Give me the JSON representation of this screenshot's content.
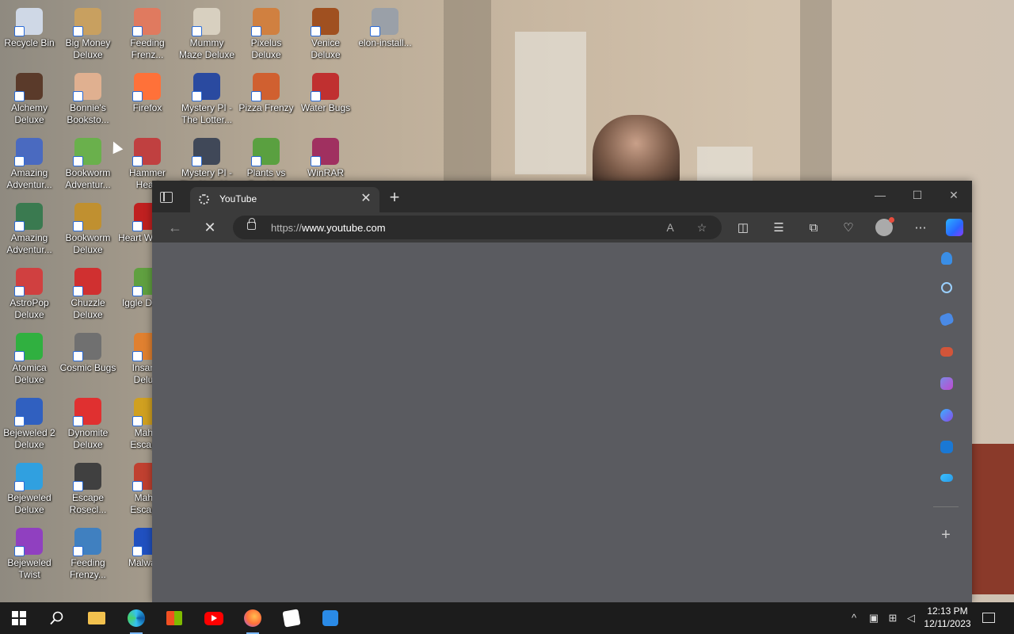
{
  "desktop": {
    "icons": [
      {
        "label": "Recycle Bin",
        "icon": "recycle-bin-icon",
        "color": "#cfd8e6"
      },
      {
        "label": "Big Money Deluxe",
        "icon": "money-bag-icon",
        "color": "#c8a060"
      },
      {
        "label": "Feeding Frenz...",
        "icon": "fish-icon",
        "color": "#e07a5f"
      },
      {
        "label": "Mummy Maze Deluxe",
        "icon": "mummy-icon",
        "color": "#d8d0c0"
      },
      {
        "label": "Pixelus Deluxe",
        "icon": "pixelus-icon",
        "color": "#d08040"
      },
      {
        "label": "Venice Deluxe",
        "icon": "gondola-icon",
        "color": "#a05020"
      },
      {
        "label": "elon-install...",
        "icon": "installer-icon",
        "color": "#9aa0a8"
      },
      {
        "label": "Alchemy Deluxe",
        "icon": "wizard-icon",
        "color": "#5a3a2a"
      },
      {
        "label": "Bonnie's Booksto...",
        "icon": "bonnie-icon",
        "color": "#e0b090"
      },
      {
        "label": "Firefox",
        "icon": "firefox-icon",
        "color": "#ff7139"
      },
      {
        "label": "Mystery PI - The Lotter...",
        "icon": "mystery-pi-icon",
        "color": "#2a4aa0"
      },
      {
        "label": "Pizza Frenzy",
        "icon": "pizza-icon",
        "color": "#d06030"
      },
      {
        "label": "Water Bugs",
        "icon": "water-bugs-icon",
        "color": "#c03030"
      },
      {
        "label": "Amazing Adventur...",
        "icon": "compass-star-icon",
        "color": "#4a6ac0"
      },
      {
        "label": "Bookworm Adventur...",
        "icon": "bookworm-icon",
        "color": "#6ab04c"
      },
      {
        "label": "Hammer Head",
        "icon": "gnome-icon",
        "color": "#c04040"
      },
      {
        "label": "Mystery PI - The New Y...",
        "icon": "mystery-pi-shield-icon",
        "color": "#404858"
      },
      {
        "label": "Plants vs Zombies",
        "icon": "plants-icon",
        "color": "#5aa040"
      },
      {
        "label": "WinRAR",
        "icon": "winrar-icon",
        "color": "#a03060"
      },
      {
        "label": "Amazing Adventur...",
        "icon": "compass-icon",
        "color": "#3a7a50"
      },
      {
        "label": "Bookworm Deluxe",
        "icon": "book-icon",
        "color": "#c09030"
      },
      {
        "label": "Heart Weap...",
        "icon": "heart-icon",
        "color": "#c02020"
      },
      {
        "label": "AstroPop Deluxe",
        "icon": "astropop-icon",
        "color": "#d04040"
      },
      {
        "label": "Chuzzle Deluxe",
        "icon": "chuzzle-icon",
        "color": "#d03030"
      },
      {
        "label": "Iggle Delu...",
        "icon": "iggle-icon",
        "color": "#60a040"
      },
      {
        "label": "Atomica Deluxe",
        "icon": "atomica-icon",
        "color": "#30b040"
      },
      {
        "label": "Cosmic Bugs",
        "icon": "cosmic-bugs-icon",
        "color": "#707070"
      },
      {
        "label": "Insaniq Delu...",
        "icon": "insaniq-icon",
        "color": "#e08030"
      },
      {
        "label": "Bejeweled 2 Deluxe",
        "icon": "bejeweled2-icon",
        "color": "#3060c0"
      },
      {
        "label": "Dynomite Deluxe",
        "icon": "dynomite-icon",
        "color": "#e03030"
      },
      {
        "label": "Mahjo Escap...",
        "icon": "mahjong-icon",
        "color": "#d0a020"
      },
      {
        "label": "Bejeweled Deluxe",
        "icon": "gem-icon",
        "color": "#30a0e0"
      },
      {
        "label": "Escape Rosecl...",
        "icon": "escape-icon",
        "color": "#404040"
      },
      {
        "label": "Mahjo Escap...",
        "icon": "mahjong-gate-icon",
        "color": "#c04030"
      },
      {
        "label": "Bejeweled Twist",
        "icon": "bejeweled-twist-icon",
        "color": "#9040c0"
      },
      {
        "label": "Feeding Frenzy...",
        "icon": "feeding-frenzy2-icon",
        "color": "#4080c0"
      },
      {
        "label": "Malwar...",
        "icon": "malwarebytes-icon",
        "color": "#2050c0"
      }
    ]
  },
  "browser": {
    "tab_title": "YouTube",
    "url_prefix": "https://",
    "url_host": "www.youtube.com",
    "window_controls": {
      "minimize": "—",
      "maximize": "☐",
      "close": "✕"
    }
  },
  "taskbar": {
    "time": "12:13 PM",
    "date": "12/11/2023"
  },
  "colors": {
    "accent": "#0078d4",
    "titlebar": "#2b2b2b",
    "toolbar": "#3b3b3b",
    "page": "#5a5b60"
  }
}
